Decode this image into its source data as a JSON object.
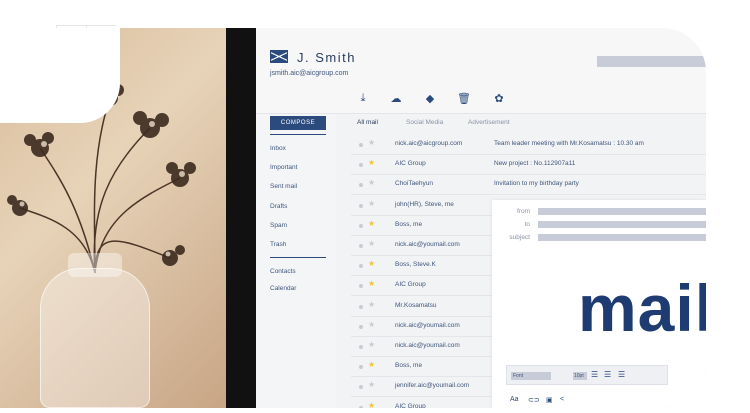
{
  "user": {
    "name": "J. Smith",
    "email": "jsmith.aic@aicgroup.com"
  },
  "toolbar": {
    "icons": [
      "download-icon",
      "cloud-icon",
      "tag-icon",
      "trash-icon",
      "settings-icon"
    ],
    "glyphs": [
      "⤓",
      "☁",
      "◆",
      "🗑",
      "✿"
    ]
  },
  "sidebar": {
    "compose_label": "COMPOSE",
    "items": [
      "Inbox",
      "Important",
      "Sent mail",
      "Drafts",
      "Spam",
      "Trash"
    ],
    "secondary": [
      "Contacts",
      "Calendar"
    ]
  },
  "tabs": [
    "All mail",
    "Social Media",
    "Advertisement"
  ],
  "mails": [
    {
      "sender": "nick.aic@aicgroup.com",
      "subject": "Team leader meeting with Mr.Kosamatsu : 10.30 am",
      "starred": false
    },
    {
      "sender": "AIC Group",
      "subject": "New project : No.112907a11",
      "starred": true
    },
    {
      "sender": "ChoiTaehyun",
      "subject": "Invitation to my birthday party",
      "starred": false
    },
    {
      "sender": "john(HR), Steve, me",
      "subject": "",
      "starred": false
    },
    {
      "sender": "Boss, me",
      "subject": "",
      "starred": true
    },
    {
      "sender": "nick.aic@youmail.com",
      "subject": "",
      "starred": false
    },
    {
      "sender": "Boss, Steve.K",
      "subject": "",
      "starred": true
    },
    {
      "sender": "AIC Group",
      "subject": "",
      "starred": true
    },
    {
      "sender": "Mr.Kosamatsu",
      "subject": "",
      "starred": false
    },
    {
      "sender": "nick.aic@youmail.com",
      "subject": "",
      "starred": false
    },
    {
      "sender": "nick.aic@youmail.com",
      "subject": "",
      "starred": false
    },
    {
      "sender": "Boss, me",
      "subject": "",
      "starred": true
    },
    {
      "sender": "jennifer.aic@youmail.com",
      "subject": "",
      "starred": false
    },
    {
      "sender": "AIC Group",
      "subject": "",
      "starred": true
    }
  ],
  "compose_window": {
    "from_label": "from",
    "to_label": "to",
    "subject_label": "subject",
    "hero_text": "mail",
    "font_label": "Font",
    "size_label": "10pt",
    "bottom_icons": [
      "Aa",
      "⊂⊃",
      "▣",
      "<"
    ]
  },
  "colors": {
    "brand": "#2b4a7d",
    "star": "#f2c62f",
    "hero": "#1e3c72"
  }
}
